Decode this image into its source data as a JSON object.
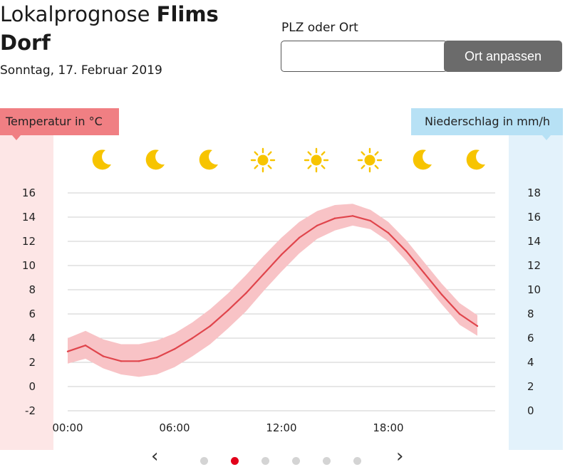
{
  "header": {
    "title_prefix": "Lokalprognose ",
    "title_location": "Flims Dorf",
    "date": "Sonntag, 17. Februar 2019"
  },
  "search": {
    "label": "PLZ oder Ort",
    "value": "",
    "placeholder": "",
    "button_label": "Ort anpassen"
  },
  "chart_data": {
    "type": "line",
    "title": "",
    "left_axis_label": "Temperatur in °C",
    "right_axis_label": "Niederschlag in mm/h",
    "x_ticks": [
      "00:00",
      "06:00",
      "12:00",
      "18:00"
    ],
    "y_left_ticks": [
      "16",
      "14",
      "12",
      "10",
      "8",
      "6",
      "4",
      "2",
      "0",
      "-2"
    ],
    "y_right_ticks": [
      "18",
      "16",
      "14",
      "12",
      "10",
      "8",
      "6",
      "4",
      "2",
      "0"
    ],
    "ylim_left": [
      -2,
      16
    ],
    "ylim_right": [
      0,
      18
    ],
    "xlim_hours": [
      0,
      24
    ],
    "grid": true,
    "weather_icons": [
      "moon-icon",
      "moon-icon",
      "moon-icon",
      "sun-icon",
      "sun-icon",
      "sun-icon",
      "moon-icon",
      "moon-icon"
    ],
    "series": [
      {
        "color": "#e0454c",
        "band_color": "#f8c3c6",
        "hours": [
          0,
          1,
          2,
          3,
          4,
          5,
          6,
          7,
          8,
          9,
          10,
          11,
          12,
          13,
          14,
          15,
          16,
          17,
          18,
          19,
          20,
          21,
          22,
          23
        ],
        "values": [
          2.9,
          3.4,
          2.5,
          2.1,
          2.1,
          2.4,
          3.1,
          4.0,
          5.0,
          6.3,
          7.7,
          9.3,
          10.9,
          12.3,
          13.3,
          13.9,
          14.1,
          13.7,
          12.7,
          11.2,
          9.4,
          7.6,
          6.0,
          5.0
        ],
        "lower": [
          1.9,
          2.3,
          1.5,
          1.0,
          0.8,
          1.0,
          1.6,
          2.5,
          3.5,
          4.8,
          6.2,
          7.9,
          9.5,
          11.0,
          12.2,
          12.9,
          13.3,
          13.0,
          12.0,
          10.4,
          8.6,
          6.8,
          5.1,
          4.2
        ],
        "upper": [
          4.0,
          4.6,
          3.9,
          3.5,
          3.5,
          3.8,
          4.4,
          5.3,
          6.4,
          7.7,
          9.2,
          10.8,
          12.3,
          13.6,
          14.5,
          15.0,
          15.1,
          14.6,
          13.6,
          12.1,
          10.3,
          8.5,
          6.9,
          5.9
        ]
      }
    ]
  },
  "pager": {
    "prev_icon": "chevron-left-icon",
    "next_icon": "chevron-right-icon",
    "dot_count": 6,
    "active_index": 1,
    "active_color": "#e2001a"
  }
}
